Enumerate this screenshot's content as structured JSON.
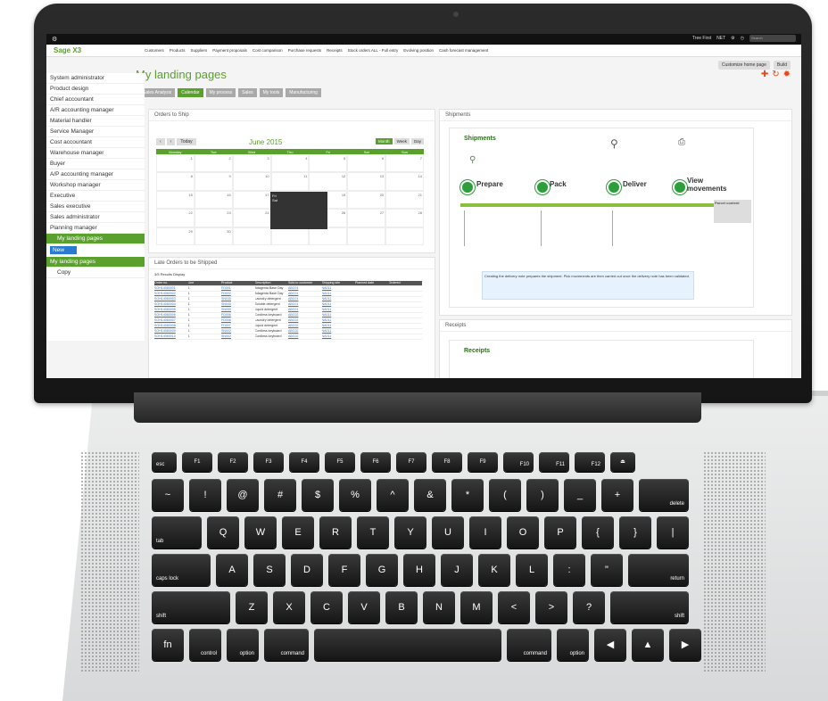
{
  "app": {
    "topbar_brand": "⚙",
    "topbar_right": [
      "Tree First",
      "NET",
      "⚙",
      "◷"
    ],
    "search_placeholder": "Search",
    "logo": "Sage X3",
    "menu_items": [
      "Customers",
      "Products",
      "Suppliers",
      "Payment proposals",
      "Cost comparison",
      "Purchase requests",
      "Receipts",
      "Stock orders ALL - Full entry",
      "Evolving position",
      "Cash forecast management"
    ]
  },
  "page": {
    "title": "My landing pages",
    "actions": [
      "Customize home page",
      "Build"
    ],
    "tabs": [
      "Sales Analysis",
      "Calendar",
      "My process",
      "Sales",
      "My tools",
      "Manufacturing"
    ],
    "active_tab": "Calendar"
  },
  "sidebar": {
    "items": [
      "System administrator",
      "Product design",
      "Chief accountant",
      "A/R accounting manager",
      "Material handler",
      "Service Manager",
      "Cost accountant",
      "Warehouse manager",
      "Buyer",
      "A/P accounting manager",
      "Workshop manager",
      "Executive",
      "Sales executive",
      "Sales administrator",
      "Planning manager"
    ],
    "selected_sub": "My landing pages",
    "new_button": "New",
    "current": "My landing pages",
    "footer_item": "Copy"
  },
  "orders_to_ship": {
    "title": "Orders to Ship",
    "month": "June 2015",
    "nav": [
      "‹",
      "›",
      "Today"
    ],
    "views": [
      "Month",
      "Week",
      "Day"
    ],
    "weekdays": [
      "Monday",
      "Tue",
      "Wed",
      "Thu",
      "Fri",
      "Sat",
      "Sun"
    ],
    "days": [
      "1",
      "2",
      "3",
      "4",
      "5",
      "6",
      "7",
      "8",
      "9",
      "10",
      "11",
      "12",
      "13",
      "14",
      "15",
      "16",
      "17",
      "18",
      "19",
      "20",
      "21",
      "22",
      "23",
      "24",
      "25",
      "26",
      "27",
      "28",
      "29",
      "30",
      "",
      "",
      "",
      "",
      ""
    ],
    "popup": [
      "Fri",
      "Sat"
    ]
  },
  "late_orders": {
    "title": "Late Orders to be Shipped",
    "summary": "3/5 Results   Display",
    "columns": [
      "Order no.",
      "Line",
      "Product",
      "Description",
      "Sold-to customer",
      "Shipping site",
      "Planned date",
      "Ordered"
    ],
    "rows": [
      [
        "SOH14060001",
        "1",
        "FD001",
        "Adagenta Base Day",
        "ABC01",
        "NA011",
        "",
        ""
      ],
      [
        "SOH14060002",
        "1",
        "FD002",
        "Adagenta Base Day",
        "ABC01",
        "NA011",
        "",
        ""
      ],
      [
        "SOH14060003",
        "1",
        "SN030",
        "Laundry detergent",
        "ABC01",
        "NA011",
        "",
        ""
      ],
      [
        "SOH14060004",
        "1",
        "SN040",
        "Soluble detergent",
        "ABC01",
        "NA011",
        "",
        ""
      ],
      [
        "SOH14060005",
        "1",
        "SN050",
        "Liquid detergent",
        "ABC01",
        "NA011",
        "",
        ""
      ],
      [
        "SOH14060006",
        "1",
        "FD006",
        "Cordless keyboard",
        "ABC02",
        "NA011",
        "",
        ""
      ],
      [
        "SOH14060007",
        "1",
        "FD006",
        "Laundry detergent",
        "ABC02",
        "NA011",
        "",
        ""
      ],
      [
        "SOH14060008",
        "1",
        "FD007",
        "Liquid detergent",
        "ABC02",
        "NA011",
        "",
        ""
      ],
      [
        "SOH14060009",
        "1",
        "SN002",
        "Cordless keyboard",
        "ABC02",
        "NA011",
        "",
        ""
      ],
      [
        "SOH14060010",
        "1",
        "SN002",
        "Cordless keyboard",
        "ABC02",
        "NA011",
        "",
        ""
      ]
    ]
  },
  "shipments": {
    "panel_title": "Shipments",
    "inner_title": "Shipments",
    "steps": [
      "Prepare",
      "Pack",
      "Deliver",
      "View movements"
    ],
    "parcel": "Parcel content",
    "note": "Creating the delivery note prepares the shipment. Pick movements are then carried out once the delivery note has been validated."
  },
  "receipts": {
    "panel_title": "Receipts",
    "inner_title": "Receipts"
  },
  "keyboard": {
    "row0": [
      "esc",
      "F1",
      "F2",
      "F3",
      "F4",
      "F5",
      "F6",
      "F7",
      "F8",
      "F9",
      "F10",
      "F11",
      "F12",
      "⏏"
    ],
    "row1": [
      "~",
      "!",
      "@",
      "#",
      "$",
      "%",
      "^",
      "&",
      "*",
      "(",
      ")",
      "_",
      "+",
      "delete"
    ],
    "row2": [
      "tab",
      "Q",
      "W",
      "E",
      "R",
      "T",
      "Y",
      "U",
      "I",
      "O",
      "P",
      "{",
      "}",
      "|"
    ],
    "row3": [
      "caps lock",
      "A",
      "S",
      "D",
      "F",
      "G",
      "H",
      "J",
      "K",
      "L",
      ":",
      "\"",
      "return"
    ],
    "row4": [
      "shift",
      "Z",
      "X",
      "C",
      "V",
      "B",
      "N",
      "M",
      "<",
      ">",
      "?",
      "shift"
    ],
    "row5": [
      "fn",
      "control",
      "option",
      "command",
      "",
      "command",
      "option",
      "◀",
      "▲",
      "▶"
    ]
  }
}
